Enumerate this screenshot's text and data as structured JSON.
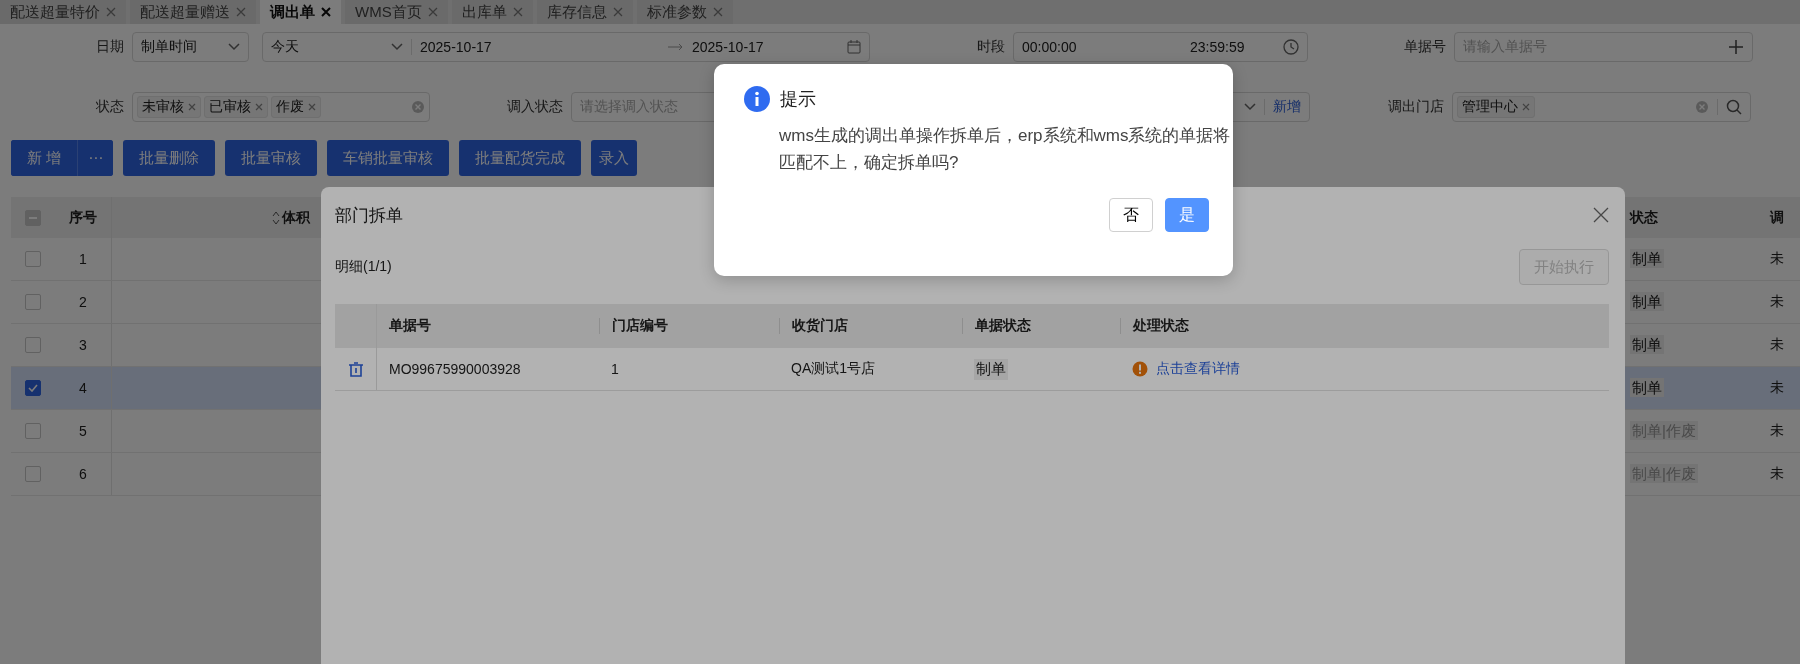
{
  "tabs": [
    {
      "label": "配送超量特价",
      "selected": false
    },
    {
      "label": "配送超量赠送",
      "selected": false
    },
    {
      "label": "调出单",
      "selected": true
    },
    {
      "label": "WMS首页",
      "selected": false
    },
    {
      "label": "出库单",
      "selected": false
    },
    {
      "label": "库存信息",
      "selected": false
    },
    {
      "label": "标准参数",
      "selected": false
    }
  ],
  "filters": {
    "date": {
      "label": "日期",
      "type": "制单时间",
      "preset": "今天",
      "start": "2025-10-17",
      "end": "2025-10-17"
    },
    "time": {
      "label": "时段",
      "start": "00:00:00",
      "end": "23:59:59"
    },
    "doc_no": {
      "label": "单据号",
      "placeholder": "请输入单据号"
    },
    "status": {
      "label": "状态",
      "tags": [
        "未审核",
        "已审核",
        "作废"
      ]
    },
    "in_status": {
      "label": "调入状态",
      "placeholder": "请选择调入状态",
      "action": "新增"
    },
    "out_store": {
      "label": "调出门店",
      "tags": [
        "管理中心"
      ]
    }
  },
  "toolbar": {
    "primary": "新 增",
    "more": "⋯",
    "buttons": [
      "批量删除",
      "批量审核",
      "车销批量审核",
      "批量配货完成",
      "录入"
    ]
  },
  "table": {
    "header_indeterminate": true,
    "columns": [
      "序号",
      "体积",
      "状态",
      "调"
    ],
    "rows": [
      {
        "no": "1",
        "status": "制单",
        "voided": false,
        "in_status": "未",
        "selected": false
      },
      {
        "no": "2",
        "status": "制单",
        "voided": false,
        "in_status": "未",
        "selected": false
      },
      {
        "no": "3",
        "status": "制单",
        "voided": false,
        "in_status": "未",
        "selected": false
      },
      {
        "no": "4",
        "status": "制单",
        "voided": false,
        "in_status": "未",
        "selected": true
      },
      {
        "no": "5",
        "status": "制单|作废",
        "voided": true,
        "in_status": "未",
        "selected": false
      },
      {
        "no": "6",
        "status": "制单|作废",
        "voided": true,
        "in_status": "未",
        "selected": false
      }
    ]
  },
  "modal": {
    "title": "部门拆单",
    "detail": "明细(1/1)",
    "run_button": {
      "label": "开始执行",
      "disabled": true
    },
    "columns": [
      "单据号",
      "门店编号",
      "收货门店",
      "单据状态",
      "处理状态"
    ],
    "rows": [
      {
        "doc_no": "MO99675990003928",
        "store_no": "1",
        "store": "QA测试1号店",
        "status": "制单",
        "process": "点击查看详情"
      }
    ]
  },
  "dialog": {
    "title": "提示",
    "message": "wms生成的调出单操作拆单后，erp系统和wms系统的单据将匹配不上，确定拆单吗?",
    "buttons": [
      {
        "label": "否",
        "primary": false
      },
      {
        "label": "是",
        "primary": true
      }
    ]
  }
}
